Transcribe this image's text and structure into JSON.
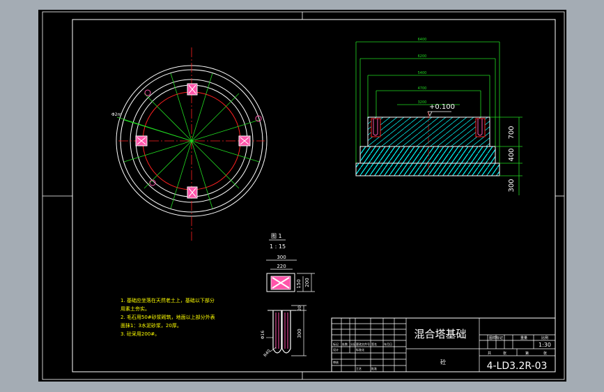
{
  "colors": {
    "background": "#a4acb4",
    "sheet": "#000000",
    "line": "#ffffff",
    "red": "#ff2020",
    "green": "#22dd22",
    "cyan": "#00ffff",
    "magenta": "#ff55aa",
    "yellow": "#ffff00"
  },
  "plan": {
    "diag_label": "Φ2m"
  },
  "section": {
    "dims_top": [
      "6400",
      "6200",
      "5400",
      "4700",
      "3200"
    ],
    "elevation": "+0.100",
    "dims_right": [
      "700",
      "400",
      "300"
    ]
  },
  "detail": {
    "title": "图 1",
    "scale": "1 : 15",
    "top_dims": [
      "300",
      "220"
    ],
    "side_dims": [
      "150",
      "200"
    ],
    "bolt_dims_side": [
      "20",
      "300"
    ],
    "bolt_label_d": "Φ16",
    "bolt_label_r": "R40"
  },
  "notes": [
    "1. 基础应坐落在天然老土上，基础以下部分",
    "用素土夯实。",
    "2. 毛石用50#砂浆砌筑，地面以上部分外表",
    "面抹1：3水泥砂浆，20厚。",
    "3. 砼采用200#。"
  ],
  "title_block": {
    "drawing_title": "混合塔基础",
    "material": "砼",
    "drawing_number": "4-LD3.2R-03",
    "scale": "1:30",
    "header_labels": [
      "图样标记",
      "重量",
      "比例"
    ],
    "sub_labels": [
      "共",
      "张",
      "第",
      "张"
    ],
    "left_labels": [
      "标记",
      "处数",
      "分区",
      "更改文件号",
      "签名",
      "年月日"
    ],
    "role_labels": [
      "设计",
      "标准化",
      "审核",
      "工艺",
      "批准"
    ]
  }
}
